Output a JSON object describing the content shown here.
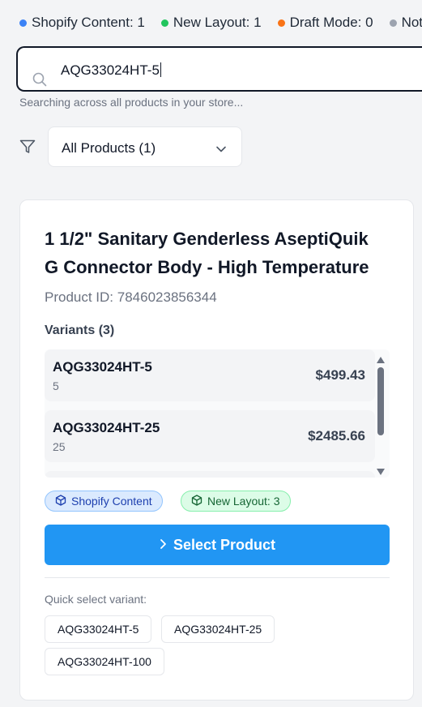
{
  "legend": [
    {
      "label": "Shopify Content: 1",
      "color": "#3b82f6"
    },
    {
      "label": "New Layout: 1",
      "color": "#22c55e"
    },
    {
      "label": "Draft Mode: 0",
      "color": "#f97316"
    },
    {
      "label": "Not",
      "color": "#9ca3af"
    }
  ],
  "search": {
    "value": "AQG33024HT-5",
    "icon": "search-icon",
    "helper": "Searching across all products in your store..."
  },
  "filter": {
    "icon": "filter-icon",
    "selected": "All Products (1)"
  },
  "product": {
    "title": "1 1/2\" Sanitary Genderless AseptiQuik G Connector Body - High Temperature",
    "product_id": "Product ID: 7846023856344",
    "variants_label": "Variants (3)",
    "variants": [
      {
        "sku": "AQG33024HT-5",
        "sub": "5",
        "price": "$499.43"
      },
      {
        "sku": "AQG33024HT-25",
        "sub": "25",
        "price": "$2485.66"
      }
    ],
    "badges": [
      {
        "label": "Shopify Content",
        "color": "#1e40af"
      },
      {
        "label": "New Layout: 3",
        "color": "#166534"
      }
    ],
    "select_button": "Select Product",
    "quick_select_label": "Quick select variant:",
    "quick_variants": [
      "AQG33024HT-5",
      "AQG33024HT-25",
      "AQG33024HT-100"
    ]
  }
}
